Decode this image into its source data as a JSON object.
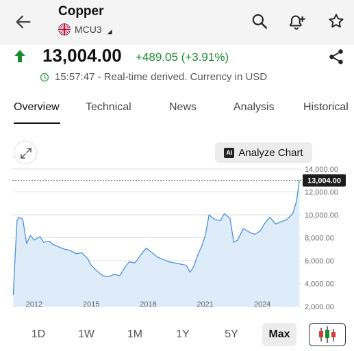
{
  "header": {
    "title": "Copper",
    "symbol": "MCU3"
  },
  "quote": {
    "price": "13,004.00",
    "change": "+489.05 (+3.91%)",
    "time_note": "15:57:47 - Real-time derived. Currency in USD",
    "direction": "up",
    "up_color": "#1a8a2e"
  },
  "tabs": [
    {
      "label": "Overview",
      "active": true
    },
    {
      "label": "Technical",
      "active": false
    },
    {
      "label": "News",
      "active": false
    },
    {
      "label": "Analysis",
      "active": false
    },
    {
      "label": "Historical",
      "active": false
    }
  ],
  "chart_toolbar": {
    "analyze_label": "Analyze Chart",
    "ai_badge": "AI"
  },
  "ranges": [
    {
      "label": "1D",
      "active": false
    },
    {
      "label": "1W",
      "active": false
    },
    {
      "label": "1M",
      "active": false
    },
    {
      "label": "1Y",
      "active": false
    },
    {
      "label": "5Y",
      "active": false
    },
    {
      "label": "Max",
      "active": true
    }
  ],
  "chart_data": {
    "type": "area",
    "x_tick_labels": [
      "2012",
      "2015",
      "2018",
      "2021",
      "2024"
    ],
    "y_tick_labels": [
      "14,000.00",
      "12,000.00",
      "10,000.00",
      "8,000.00",
      "6,000.00",
      "4,000.00",
      "2,000.00"
    ],
    "ylim": [
      2000,
      14000
    ],
    "xlim": [
      2010.85,
      2026.05
    ],
    "last_value": 13004,
    "last_label": "13,004.00",
    "line_color": "#4a90d9",
    "fill_color": "#deecfa",
    "grid": true,
    "series": [
      {
        "x": [
          2010.9,
          2011.0,
          2011.1,
          2011.2,
          2011.4,
          2011.6,
          2011.8,
          2012.0,
          2012.3,
          2012.5,
          2012.8,
          2013.0,
          2013.3,
          2013.6,
          2013.9,
          2014.2,
          2014.5,
          2014.8,
          2015.0,
          2015.3,
          2015.6,
          2015.9,
          2016.2,
          2016.5,
          2016.8,
          2017.0,
          2017.3,
          2017.6,
          2017.9,
          2018.2,
          2018.5,
          2018.8,
          2019.1,
          2019.4,
          2019.7,
          2020.0,
          2020.2,
          2020.4,
          2020.6,
          2020.8,
          2021.0,
          2021.2,
          2021.5,
          2021.8,
          2022.0,
          2022.3,
          2022.5,
          2022.7,
          2023.0,
          2023.3,
          2023.6,
          2023.9,
          2024.1,
          2024.4,
          2024.7,
          2025.0,
          2025.3,
          2025.6,
          2025.8,
          2025.95
        ],
        "y": [
          3000,
          6500,
          9500,
          9800,
          9600,
          7500,
          8200,
          7800,
          8100,
          7600,
          7700,
          7400,
          7200,
          7000,
          6900,
          6600,
          6700,
          6200,
          5600,
          5100,
          4700,
          4600,
          4800,
          4700,
          5500,
          5900,
          5800,
          6500,
          7100,
          6700,
          6300,
          6100,
          5900,
          5800,
          5700,
          5600,
          5000,
          5500,
          6500,
          7200,
          8200,
          10000,
          9600,
          9500,
          10100,
          9700,
          7600,
          7800,
          8800,
          8500,
          8300,
          8600,
          9200,
          9800,
          9200,
          9400,
          9600,
          10100,
          11200,
          13004
        ]
      }
    ]
  }
}
